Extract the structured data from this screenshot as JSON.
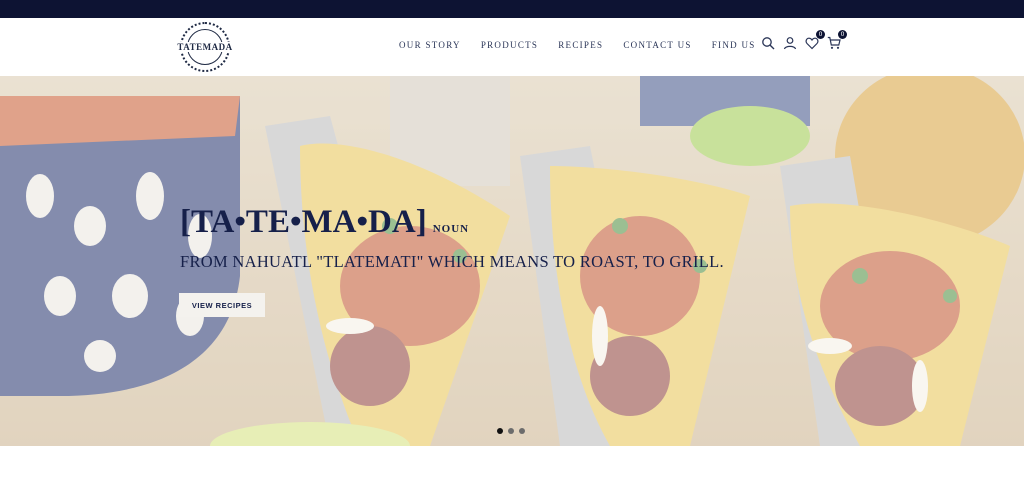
{
  "brand": {
    "logo_text": "TATEMADA"
  },
  "nav": {
    "items": [
      {
        "label": "OUR STORY"
      },
      {
        "label": "PRODUCTS"
      },
      {
        "label": "RECIPES"
      },
      {
        "label": "CONTACT US"
      },
      {
        "label": "FIND US"
      }
    ]
  },
  "header_icons": {
    "search": "search-icon",
    "account": "user-icon",
    "wishlist": {
      "icon": "heart-icon",
      "count": "0"
    },
    "cart": {
      "icon": "cart-icon",
      "count": "0"
    }
  },
  "hero": {
    "title": "[TA•TE•MA•DA]",
    "title_suffix": "NOUN",
    "subtitle": "FROM NAHUATL \"TLATEMATI\" WHICH MEANS TO ROAST, TO GRILL.",
    "button_label": "VIEW RECIPES",
    "slides": 3,
    "active_slide": 1
  },
  "colors": {
    "topbar": "#0d1333",
    "accent_navy": "#16204a"
  }
}
